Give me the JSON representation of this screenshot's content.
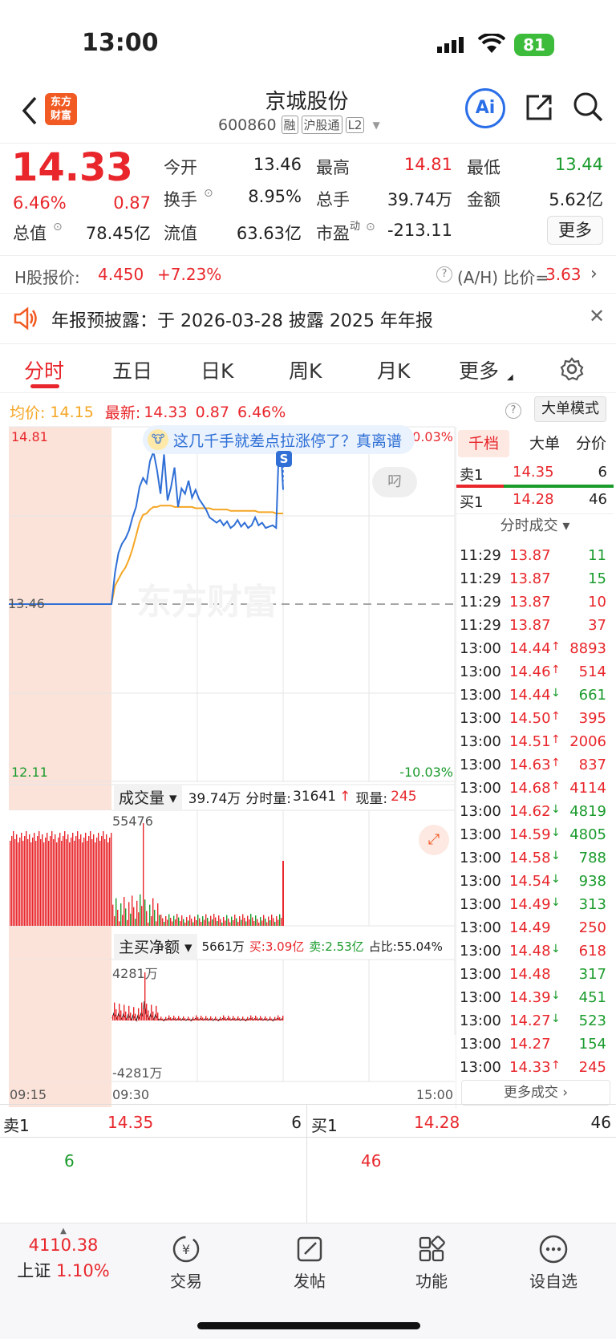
{
  "status_bar": {
    "time": "13:00",
    "battery": "81"
  },
  "nav": {
    "logo_line1": "东方",
    "logo_line2": "财富",
    "title": "京城股份",
    "code": "600860",
    "tags": [
      "融",
      "沪股通",
      "L2"
    ],
    "ai_label": "Ai"
  },
  "quote": {
    "price": "14.33",
    "change_pct": "6.46%",
    "change": "0.87",
    "open_label": "今开",
    "open": "13.46",
    "high_label": "最高",
    "high": "14.81",
    "low_label": "最低",
    "low": "13.44",
    "turnover_label": "换手",
    "turnover": "8.95%",
    "volume_label": "总手",
    "volume": "39.74万",
    "amount_label": "金额",
    "amount": "5.62亿",
    "mktcap_label": "总值",
    "mktcap": "78.45亿",
    "float_label": "流值",
    "float": "63.63亿",
    "pe_label": "市盈",
    "pe_sup": "动",
    "pe": "-213.11",
    "more_button": "更多"
  },
  "hshare": {
    "label": "H股报价:",
    "price": "4.450",
    "change": "+7.23%",
    "ah_label": "(A/H) 比价=",
    "ah_value": "3.63"
  },
  "notice": {
    "text": "年报预披露：于 2026-03-28 披露 2025 年年报"
  },
  "tabs": [
    "分时",
    "五日",
    "日K",
    "周K",
    "月K",
    "更多"
  ],
  "chart_header": {
    "avg_label": "均价:",
    "avg": "14.15",
    "latest_label": "最新:",
    "latest": "14.33",
    "change": "0.87",
    "pct": "6.46%",
    "mode_button": "大单模式"
  },
  "chart_data": {
    "type": "line",
    "ylim": [
      12.11,
      14.81
    ],
    "prev_close": 13.46,
    "y_labels": {
      "top": "14.81",
      "mid": "13.46",
      "bottom": "12.11",
      "top_pct": "10.03%",
      "bottom_pct": "-10.03%"
    },
    "x_labels": [
      "09:15",
      "09:30",
      "15:00"
    ],
    "price_series": [
      13.46,
      13.46,
      13.46,
      13.46,
      13.46,
      13.46,
      13.46,
      13.46,
      13.46,
      13.46,
      13.46,
      13.46,
      13.46,
      13.46,
      13.46,
      13.46,
      13.46,
      13.46,
      13.46,
      13.46,
      13.46,
      13.46,
      13.46,
      13.46,
      13.46,
      13.7,
      13.85,
      13.92,
      13.96,
      14.02,
      14.12,
      14.2,
      14.35,
      14.42,
      14.38,
      14.55,
      14.62,
      14.48,
      14.3,
      14.6,
      14.25,
      14.35,
      14.5,
      14.2,
      14.34,
      14.3,
      14.4,
      14.27,
      14.33,
      14.26,
      14.22,
      14.18,
      14.12,
      14.1,
      14.08,
      14.1,
      14.06,
      14.09,
      14.04,
      14.06,
      14.1,
      14.05,
      14.08,
      14.04,
      14.06,
      14.12,
      14.06,
      14.08,
      14.04,
      14.05,
      14.06,
      14.04,
      14.81,
      14.33
    ],
    "avg_series": [
      13.46,
      13.46,
      13.46,
      13.46,
      13.46,
      13.46,
      13.46,
      13.46,
      13.46,
      13.46,
      13.46,
      13.46,
      13.46,
      13.46,
      13.46,
      13.46,
      13.46,
      13.46,
      13.46,
      13.46,
      13.46,
      13.46,
      13.46,
      13.46,
      13.46,
      13.6,
      13.65,
      13.7,
      13.74,
      13.8,
      13.88,
      13.98,
      14.08,
      14.14,
      14.15,
      14.18,
      14.2,
      14.2,
      14.21,
      14.21,
      14.21,
      14.21,
      14.2,
      14.2,
      14.2,
      14.2,
      14.2,
      14.2,
      14.19,
      14.19,
      14.19,
      14.19,
      14.19,
      14.18,
      14.18,
      14.18,
      14.18,
      14.18,
      14.17,
      14.17,
      14.17,
      14.17,
      14.17,
      14.17,
      14.17,
      14.17,
      14.16,
      14.16,
      14.16,
      14.16,
      14.16,
      14.15,
      14.15,
      14.15
    ]
  },
  "bubble": {
    "text": "这几千手就差点拉涨停了？真离谱",
    "badge": "S",
    "reply": "叼"
  },
  "watermark": "东方财富",
  "volume_panel": {
    "selector": "成交量",
    "total": "39.74万",
    "minute_label": "分时量:",
    "minute": "31641",
    "now_label": "现量:",
    "now": "245",
    "max": "55476"
  },
  "netbuy_panel": {
    "selector": "主买净额",
    "value": "5661万",
    "buy": "买:3.09亿",
    "sell": "卖:2.53亿",
    "ratio": "占比:55.04%",
    "top": "4281万",
    "bottom": "-4281万"
  },
  "side": {
    "tabs": [
      "千档",
      "大单",
      "分价"
    ],
    "sell1_label": "卖1",
    "sell1_price": "14.35",
    "sell1_vol": "6",
    "buy1_label": "买1",
    "buy1_price": "14.28",
    "buy1_vol": "46",
    "trades_title": "分时成交",
    "trades": [
      [
        "11:29",
        "13.87",
        "",
        "11",
        "green"
      ],
      [
        "11:29",
        "13.87",
        "",
        "15",
        "green"
      ],
      [
        "11:29",
        "13.87",
        "",
        "10",
        "red"
      ],
      [
        "11:29",
        "13.87",
        "",
        "37",
        "red"
      ],
      [
        "13:00",
        "14.44",
        "↑",
        "8893",
        "red"
      ],
      [
        "13:00",
        "14.46",
        "↑",
        "514",
        "red"
      ],
      [
        "13:00",
        "14.44",
        "↓",
        "661",
        "green"
      ],
      [
        "13:00",
        "14.50",
        "↑",
        "395",
        "red"
      ],
      [
        "13:00",
        "14.51",
        "↑",
        "2006",
        "red"
      ],
      [
        "13:00",
        "14.63",
        "↑",
        "837",
        "red"
      ],
      [
        "13:00",
        "14.68",
        "↑",
        "4114",
        "red"
      ],
      [
        "13:00",
        "14.62",
        "↓",
        "4819",
        "green"
      ],
      [
        "13:00",
        "14.59",
        "↓",
        "4805",
        "green"
      ],
      [
        "13:00",
        "14.58",
        "↓",
        "788",
        "green"
      ],
      [
        "13:00",
        "14.54",
        "↓",
        "938",
        "green"
      ],
      [
        "13:00",
        "14.49",
        "↓",
        "313",
        "green"
      ],
      [
        "13:00",
        "14.49",
        "",
        "250",
        "red"
      ],
      [
        "13:00",
        "14.48",
        "↓",
        "618",
        "red"
      ],
      [
        "13:00",
        "14.48",
        "",
        "317",
        "green"
      ],
      [
        "13:00",
        "14.39",
        "↓",
        "451",
        "green"
      ],
      [
        "13:00",
        "14.27",
        "↓",
        "523",
        "green"
      ],
      [
        "13:00",
        "14.27",
        "",
        "154",
        "green"
      ],
      [
        "13:00",
        "14.33",
        "↑",
        "245",
        "red"
      ]
    ],
    "more_trades": "更多成交"
  },
  "book": {
    "sell1_label": "卖1",
    "sell1_price": "14.35",
    "sell1_vol": "6",
    "sell1_detail": "6",
    "buy1_label": "买1",
    "buy1_price": "14.28",
    "buy1_vol": "46",
    "buy1_detail": "46"
  },
  "tabbar": {
    "index_value": "4110.38",
    "index_name": "上证",
    "index_pct": "1.10%",
    "items": [
      "交易",
      "发帖",
      "功能",
      "设自选"
    ]
  }
}
